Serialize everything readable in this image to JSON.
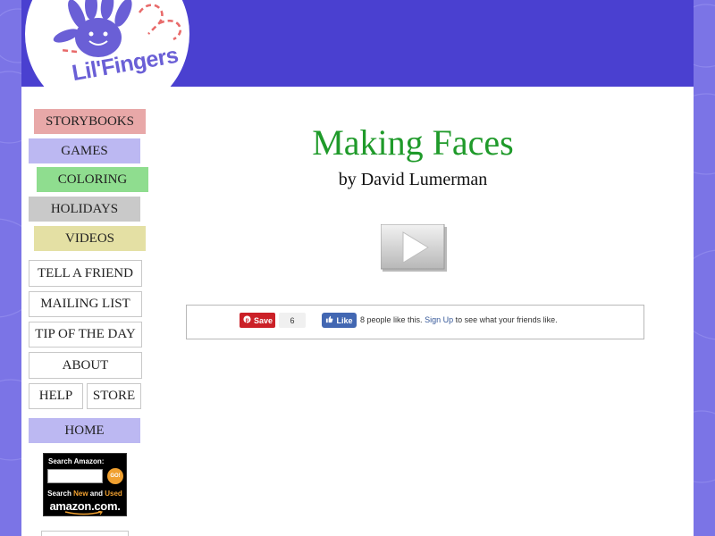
{
  "logo": {
    "text": "Lil'Fingers"
  },
  "nav": {
    "storybooks": "STORYBOOKS",
    "games": "GAMES",
    "coloring": "COLORING",
    "holidays": "HOLIDAYS",
    "videos": "VIDEOS",
    "home": "HOME"
  },
  "sidebar": {
    "tell_a_friend": "TELL A FRIEND",
    "mailing_list": "MAILING LIST",
    "tip_of_the_day": "TIP OF THE DAY",
    "about": "ABOUT",
    "help": "HELP",
    "store": "STORE"
  },
  "amazon": {
    "search_label": "Search Amazon:",
    "go_label": "GO!",
    "line1_prefix": "Search",
    "line1_new": "New",
    "line1_mid": "and",
    "line1_used": "Used",
    "brand": "amazon.com."
  },
  "content": {
    "title": "Making Faces",
    "author": "by David Lumerman"
  },
  "share": {
    "pin_save": "Save",
    "pin_count": "6",
    "fb_like": "Like",
    "fb_count_text": "8 people like this.",
    "fb_signup": "Sign Up",
    "fb_suffix": "to see what your friends like."
  },
  "colors": {
    "background": "#7b74e6",
    "header": "#4a40d0",
    "title": "#1f9a2a",
    "storybooks": "#e8a8a8",
    "games": "#bcb8f2",
    "coloring": "#8fdd8f",
    "holidays": "#c9c9c9",
    "videos": "#e4e0a4"
  }
}
